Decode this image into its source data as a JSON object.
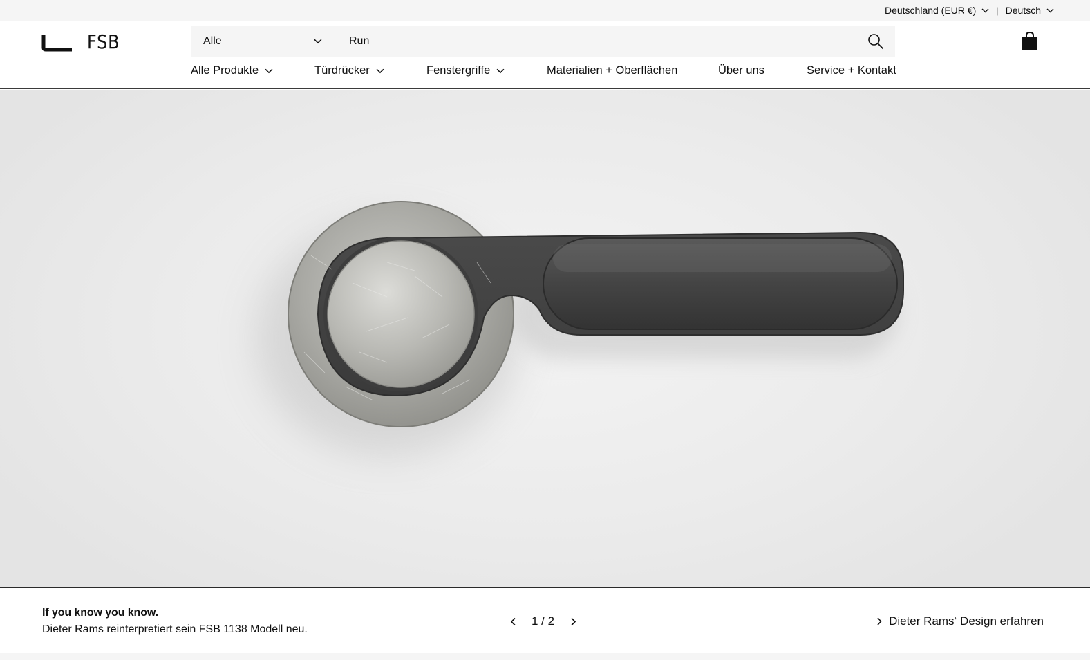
{
  "utility_bar": {
    "country": "Deutschland (EUR €)",
    "separator": "|",
    "language": "Deutsch"
  },
  "brand": {
    "name": "FSB"
  },
  "search": {
    "category": "Alle",
    "query": "Run"
  },
  "nav": {
    "items": [
      {
        "label": "Alle Produkte"
      },
      {
        "label": "Türdrücker"
      },
      {
        "label": "Fenstergriffe"
      },
      {
        "label": "Materialien + Oberflächen"
      },
      {
        "label": "Über uns"
      },
      {
        "label": "Service + Kontakt"
      }
    ]
  },
  "hero": {
    "image_subject": "door-handle"
  },
  "slide": {
    "title": "If you know you know.",
    "subtitle": "Dieter Rams reinterpretiert sein FSB 1138 Modell neu.",
    "pager": "1 / 2",
    "cta": "Dieter Rams‘ Design erfahren"
  },
  "icons": {
    "search": "search-icon",
    "cart": "shopping-bag-icon",
    "chevron": "chevron-down-icon",
    "prev": "chevron-left-icon",
    "next": "chevron-right-icon"
  }
}
